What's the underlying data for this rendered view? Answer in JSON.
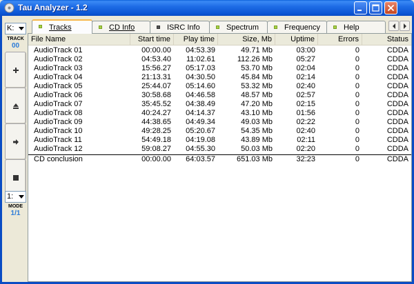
{
  "window": {
    "title": "Tau Analyzer - 1.2"
  },
  "leftbar": {
    "drive": "K:",
    "track_label": "TRACK",
    "track_value": "00",
    "mode_select": "1:",
    "mode_label": "MODE",
    "mode_value": "1/1"
  },
  "tabs": [
    {
      "label": "Tracks",
      "active": true
    },
    {
      "label": "CD Info",
      "active": false
    },
    {
      "label": "ISRC Info",
      "active": false
    },
    {
      "label": "Spectrum",
      "active": false
    },
    {
      "label": "Frequency",
      "active": false
    },
    {
      "label": "Help",
      "active": false
    }
  ],
  "table": {
    "columns": [
      "File Name",
      "Start time",
      "Play time",
      "Size, Mb",
      "Uptime",
      "Errors",
      "Status"
    ],
    "rows": [
      [
        "AudioTrack 01",
        "00:00.00",
        "04:53.39",
        "49.71 Mb",
        "03:00",
        "0",
        "CDDA"
      ],
      [
        "AudioTrack 02",
        "04:53.40",
        "11:02.61",
        "112.26 Mb",
        "05:27",
        "0",
        "CDDA"
      ],
      [
        "AudioTrack 03",
        "15:56.27",
        "05:17.03",
        "53.70 Mb",
        "02:04",
        "0",
        "CDDA"
      ],
      [
        "AudioTrack 04",
        "21:13.31",
        "04:30.50",
        "45.84 Mb",
        "02:14",
        "0",
        "CDDA"
      ],
      [
        "AudioTrack 05",
        "25:44.07",
        "05:14.60",
        "53.32 Mb",
        "02:40",
        "0",
        "CDDA"
      ],
      [
        "AudioTrack 06",
        "30:58.68",
        "04:46.58",
        "48.57 Mb",
        "02:57",
        "0",
        "CDDA"
      ],
      [
        "AudioTrack 07",
        "35:45.52",
        "04:38.49",
        "47.20 Mb",
        "02:15",
        "0",
        "CDDA"
      ],
      [
        "AudioTrack 08",
        "40:24.27",
        "04:14.37",
        "43.10 Mb",
        "01:56",
        "0",
        "CDDA"
      ],
      [
        "AudioTrack 09",
        "44:38.65",
        "04:49.34",
        "49.03 Mb",
        "02:22",
        "0",
        "CDDA"
      ],
      [
        "AudioTrack 10",
        "49:28.25",
        "05:20.67",
        "54.35 Mb",
        "02:40",
        "0",
        "CDDA"
      ],
      [
        "AudioTrack 11",
        "54:49.18",
        "04:19.08",
        "43.89 Mb",
        "02:11",
        "0",
        "CDDA"
      ],
      [
        "AudioTrack 12",
        "59:08.27",
        "04:55.30",
        "50.03 Mb",
        "02:20",
        "0",
        "CDDA"
      ]
    ],
    "summary": [
      "CD conclusion",
      "00:00.00",
      "64:03.57",
      "651.03 Mb",
      "32:23",
      "0",
      "CDDA"
    ]
  }
}
